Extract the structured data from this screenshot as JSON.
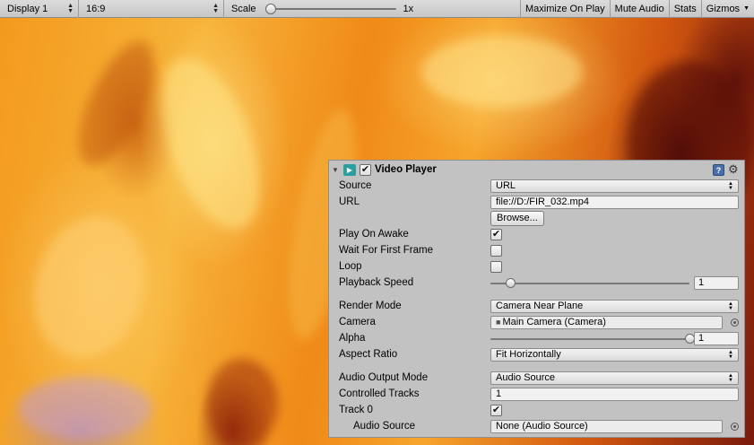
{
  "toolbar": {
    "display": "Display 1",
    "aspect": "16:9",
    "scale_label": "Scale",
    "scale_value": "1x",
    "scale_level": 0,
    "maximize_on_play": "Maximize On Play",
    "mute_audio": "Mute Audio",
    "stats": "Stats",
    "gizmos": "Gizmos"
  },
  "component": {
    "title": "Video Player",
    "enabled": true,
    "icon_color": "#2b9f9f"
  },
  "fields": {
    "source": {
      "label": "Source",
      "value": "URL"
    },
    "url": {
      "label": "URL",
      "value": "file://D:/FIR_032.mp4"
    },
    "browse": "Browse...",
    "play_on_awake": {
      "label": "Play On Awake",
      "checked": "✔"
    },
    "wait_for_first_frame": {
      "label": "Wait For First Frame"
    },
    "loop": {
      "label": "Loop"
    },
    "playback_speed": {
      "label": "Playback Speed",
      "value": "1",
      "slider_fraction": 0.1
    },
    "render_mode": {
      "label": "Render Mode",
      "value": "Camera Near Plane"
    },
    "camera": {
      "label": "Camera",
      "value": "Main Camera (Camera)"
    },
    "alpha": {
      "label": "Alpha",
      "value": "1",
      "slider_fraction": 1.0
    },
    "aspect_ratio": {
      "label": "Aspect Ratio",
      "value": "Fit Horizontally"
    },
    "audio_output_mode": {
      "label": "Audio Output Mode",
      "value": "Audio Source"
    },
    "controlled_tracks": {
      "label": "Controlled Tracks",
      "value": "1"
    },
    "track_0": {
      "label": "Track 0",
      "checked": "✔"
    },
    "audio_source": {
      "label": "Audio Source",
      "value": "None (Audio Source)"
    }
  },
  "icons": {
    "help": "?",
    "gear": "⚙",
    "fold": "▼",
    "video": "▶"
  }
}
